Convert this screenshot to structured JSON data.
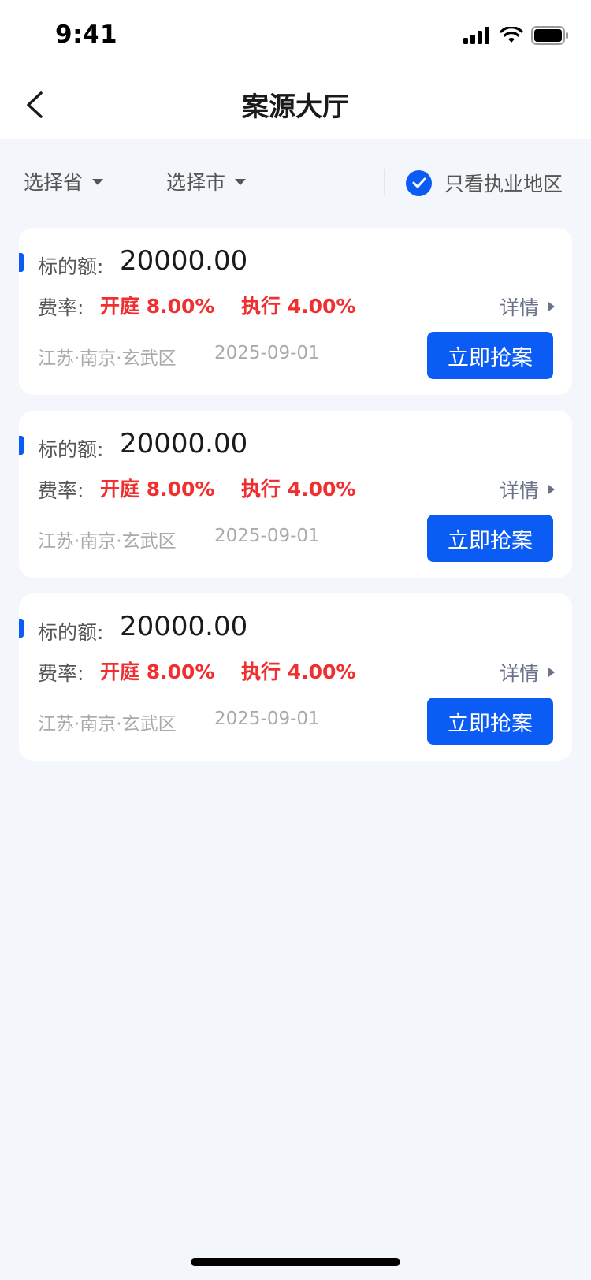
{
  "status_bar": {
    "time": "9:41"
  },
  "header": {
    "title": "案源大厅"
  },
  "filters": {
    "province": "选择省",
    "city": "选择市",
    "only_practice_region": "只看执业地区",
    "only_practice_region_checked": true
  },
  "cards": [
    {
      "amount_label": "标的额:",
      "amount": "20000.00",
      "rate_label": "费率:",
      "rate_court": "开庭 8.00%",
      "rate_exec": "执行 4.00%",
      "detail": "详情",
      "location": "江苏·南京·玄武区",
      "date": "2025-09-01",
      "action": "立即抢案"
    },
    {
      "amount_label": "标的额:",
      "amount": "20000.00",
      "rate_label": "费率:",
      "rate_court": "开庭 8.00%",
      "rate_exec": "执行 4.00%",
      "detail": "详情",
      "location": "江苏·南京·玄武区",
      "date": "2025-09-01",
      "action": "立即抢案"
    },
    {
      "amount_label": "标的额:",
      "amount": "20000.00",
      "rate_label": "费率:",
      "rate_court": "开庭 8.00%",
      "rate_exec": "执行 4.00%",
      "detail": "详情",
      "location": "江苏·南京·玄武区",
      "date": "2025-09-01",
      "action": "立即抢案"
    }
  ],
  "colors": {
    "accent": "#0B5CF5",
    "rate": "#F03030",
    "background": "#F3F6FB"
  },
  "icons": [
    "signal-icon",
    "wifi-icon",
    "battery-icon",
    "back-arrow-icon",
    "chevron-down-icon",
    "check-icon",
    "caret-right-icon"
  ]
}
